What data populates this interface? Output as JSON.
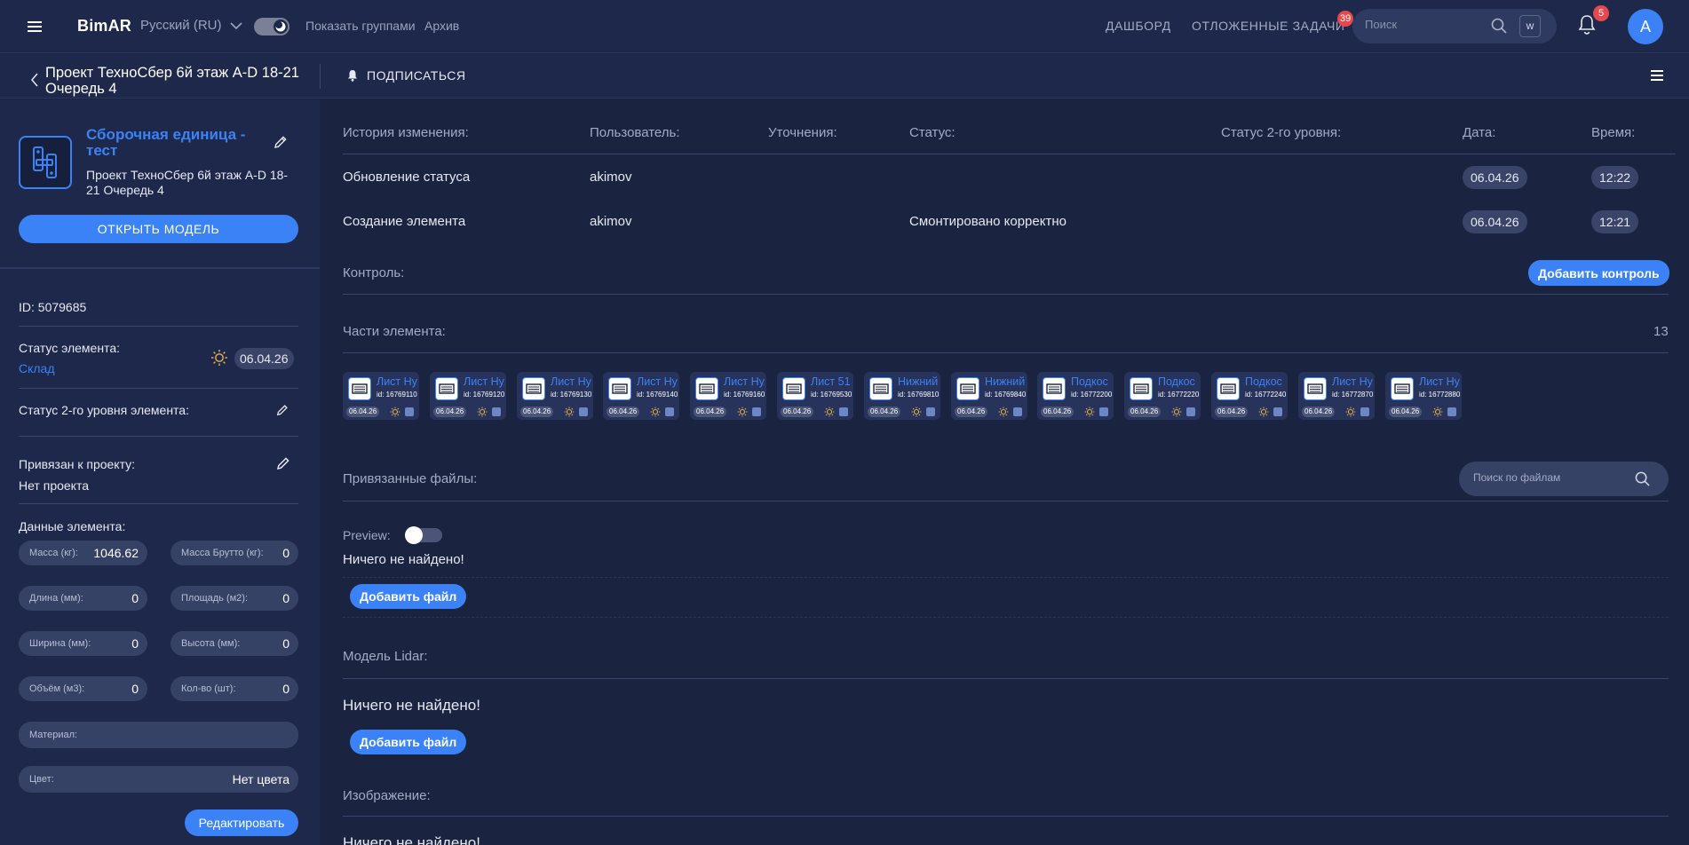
{
  "topbar": {
    "app_name": "BimAR",
    "language": "Русский (RU)",
    "show_groups": "Показать группами",
    "archive": "Архив",
    "nav_dashboard": "ДАШБОРД",
    "nav_deferred": "ОТЛОЖЕННЫЕ ЗАДАЧИ",
    "deferred_count": "39",
    "search_placeholder": "Поиск",
    "search_key": "w",
    "notifications_count": "5",
    "avatar_letter": "A"
  },
  "subbar": {
    "project_title": "Проект ТехноСбер 6й этаж A-D 18-21 Очередь 4",
    "subscribe_label": "ПОДПИСАТЬСЯ"
  },
  "element": {
    "title": "Сборочная единица - тест",
    "project": "Проект ТехноСбер 6й этаж A-D 18-21 Очередь 4",
    "open_model_label": "ОТКРЫТЬ МОДЕЛЬ",
    "id_text": "ID: 5079685",
    "status_label": "Статус элемента:",
    "status_value": "Склад",
    "status_date": "06.04.26",
    "status2_label": "Статус 2-го уровня элемента:",
    "project_link_label": "Привязан к проекту:",
    "project_link_value": "Нет проекта",
    "data_label": "Данные элемента:",
    "fields": {
      "mass": {
        "label": "Масса (кг):",
        "value": "1046.62"
      },
      "mass_gross": {
        "label": "Масса Брутто (кг):",
        "value": "0"
      },
      "length": {
        "label": "Длина (мм):",
        "value": "0"
      },
      "area": {
        "label": "Площадь (м2):",
        "value": "0"
      },
      "width": {
        "label": "Ширина (мм):",
        "value": "0"
      },
      "height": {
        "label": "Высота (мм):",
        "value": "0"
      },
      "volume": {
        "label": "Объём (м3):",
        "value": "0"
      },
      "quantity": {
        "label": "Кол-во (шт):",
        "value": "0"
      },
      "material": {
        "label": "Материал:",
        "value": ""
      },
      "color": {
        "label": "Цвет:",
        "value": "Нет цвета"
      }
    },
    "edit_label": "Редактировать"
  },
  "history": {
    "headers": {
      "change": "История изменения:",
      "user": "Пользователь:",
      "notes": "Уточнения:",
      "status": "Статус:",
      "status2": "Статус 2-го уровня:",
      "date": "Дата:",
      "time": "Время:"
    },
    "rows": [
      {
        "change": "Обновление статуса",
        "user": "akimov",
        "status": "",
        "date": "06.04.26",
        "time": "12:22"
      },
      {
        "change": "Создание элемента",
        "user": "akimov",
        "status": "Смонтировано корректно",
        "date": "06.04.26",
        "time": "12:21"
      }
    ]
  },
  "control": {
    "label": "Контроль:",
    "add_label": "Добавить контроль"
  },
  "parts": {
    "label": "Части элемента:",
    "count": "13",
    "items": [
      {
        "name": "Лист Нуль",
        "id": "id: 16769110",
        "date": "06.04.26"
      },
      {
        "name": "Лист Нуль",
        "id": "id: 16769120",
        "date": "06.04.26"
      },
      {
        "name": "Лист Нуль",
        "id": "id: 16769130",
        "date": "06.04.26"
      },
      {
        "name": "Лист Нуль",
        "id": "id: 16769140",
        "date": "06.04.26"
      },
      {
        "name": "Лист Нуль",
        "id": "id: 16769160",
        "date": "06.04.26"
      },
      {
        "name": "Лист 51",
        "id": "id: 16769530",
        "date": "06.04.26"
      },
      {
        "name": "Нижний",
        "id": "id: 16769810",
        "date": "06.04.26"
      },
      {
        "name": "Нижний",
        "id": "id: 16769840",
        "date": "06.04.26"
      },
      {
        "name": "Подкос",
        "id": "id: 16772200",
        "date": "06.04.26"
      },
      {
        "name": "Подкос",
        "id": "id: 16772220",
        "date": "06.04.26"
      },
      {
        "name": "Подкос",
        "id": "id: 16772240",
        "date": "06.04.26"
      },
      {
        "name": "Лист Нуль",
        "id": "id: 16772870",
        "date": "06.04.26"
      },
      {
        "name": "Лист Нуль",
        "id": "id: 16772880",
        "date": "06.04.26"
      }
    ]
  },
  "files": {
    "label": "Привязанные файлы:",
    "search_placeholder": "Поиск по файлам",
    "preview_label": "Preview:",
    "empty_text": "Ничего не найдено!",
    "add_label": "Добавить файл"
  },
  "lidar": {
    "label": "Модель Lidar:",
    "empty_text": "Ничего не найдено!",
    "add_label": "Добавить файл"
  },
  "images": {
    "label": "Изображение:",
    "empty_text": "Ничего не найдено!"
  }
}
